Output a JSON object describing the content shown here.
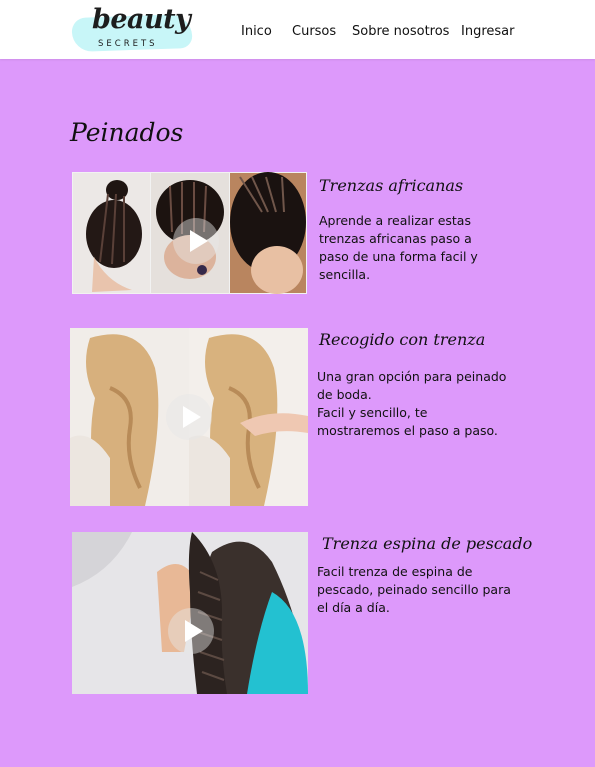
{
  "header": {
    "logo": {
      "script": "beauty",
      "caps": "SECRETS"
    },
    "nav": [
      "Inico",
      "Cursos",
      "Sobre nosotros",
      "Ingresar"
    ]
  },
  "section": {
    "title": "Peinados"
  },
  "cards": [
    {
      "title": "Trenzas africanas",
      "desc": [
        "Aprende a realizar estas trenzas africanas paso a paso de una forma facil y sencilla."
      ]
    },
    {
      "title": "Recogido con trenza",
      "desc": [
        "Una gran opción para peinado de boda.",
        "Facil y sencillo, te mostraremos el paso a paso."
      ]
    },
    {
      "title": "Trenza espina de pescado",
      "desc": [
        "Facil trenza de espina de pescado, peinado sencillo para el día a día."
      ]
    }
  ],
  "colors": {
    "background": "#dd99fb",
    "header": "#ffffff",
    "logo_splash": "#c8f6f8"
  }
}
